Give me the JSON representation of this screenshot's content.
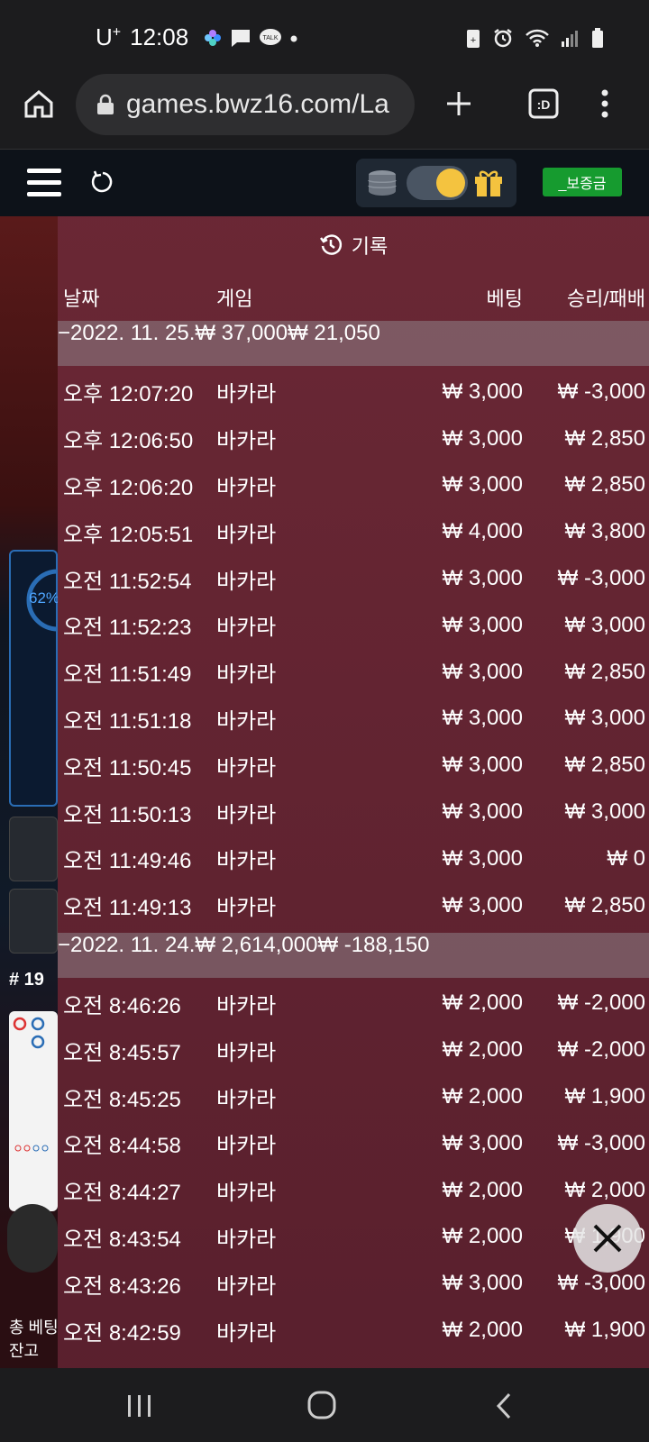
{
  "status_bar": {
    "carrier": "U",
    "carrier_sup": "+",
    "time": "12:08"
  },
  "browser": {
    "url": "games.bwz16.com/La"
  },
  "game_header": {
    "bonus_label": "_보증금"
  },
  "background": {
    "percent": "62%",
    "round_label": "# 19",
    "total_bet_label": "총 베팅",
    "balance_label": "잔고"
  },
  "history": {
    "title": "기록",
    "columns": [
      "날짜",
      "게임",
      "베팅",
      "승리/패배"
    ],
    "groups": [
      {
        "date": "−2022. 11. 25.",
        "total_bet": "₩ 37,000",
        "total_result": "₩ 21,050",
        "rows": [
          [
            "오후 12:07:20",
            "바카라",
            "₩ 3,000",
            "₩ -3,000"
          ],
          [
            "오후 12:06:50",
            "바카라",
            "₩ 3,000",
            "₩ 2,850"
          ],
          [
            "오후 12:06:20",
            "바카라",
            "₩ 3,000",
            "₩ 2,850"
          ],
          [
            "오후 12:05:51",
            "바카라",
            "₩ 4,000",
            "₩ 3,800"
          ],
          [
            "오전 11:52:54",
            "바카라",
            "₩ 3,000",
            "₩ -3,000"
          ],
          [
            "오전 11:52:23",
            "바카라",
            "₩ 3,000",
            "₩ 3,000"
          ],
          [
            "오전 11:51:49",
            "바카라",
            "₩ 3,000",
            "₩ 2,850"
          ],
          [
            "오전 11:51:18",
            "바카라",
            "₩ 3,000",
            "₩ 3,000"
          ],
          [
            "오전 11:50:45",
            "바카라",
            "₩ 3,000",
            "₩ 2,850"
          ],
          [
            "오전 11:50:13",
            "바카라",
            "₩ 3,000",
            "₩ 3,000"
          ],
          [
            "오전 11:49:46",
            "바카라",
            "₩ 3,000",
            "₩ 0"
          ],
          [
            "오전 11:49:13",
            "바카라",
            "₩ 3,000",
            "₩ 2,850"
          ]
        ]
      },
      {
        "date": "−2022. 11. 24.",
        "total_bet": "₩ 2,614,000",
        "total_result": "₩ -188,150",
        "rows": [
          [
            "오전 8:46:26",
            "바카라",
            "₩ 2,000",
            "₩ -2,000"
          ],
          [
            "오전 8:45:57",
            "바카라",
            "₩ 2,000",
            "₩ -2,000"
          ],
          [
            "오전 8:45:25",
            "바카라",
            "₩ 2,000",
            "₩ 1,900"
          ],
          [
            "오전 8:44:58",
            "바카라",
            "₩ 3,000",
            "₩ -3,000"
          ],
          [
            "오전 8:44:27",
            "바카라",
            "₩ 2,000",
            "₩ 2,000"
          ],
          [
            "오전 8:43:54",
            "바카라",
            "₩ 2,000",
            "₩ 1,900"
          ],
          [
            "오전 8:43:26",
            "바카라",
            "₩ 3,000",
            "₩ -3,000"
          ],
          [
            "오전 8:42:59",
            "바카라",
            "₩ 2,000",
            "₩ 1,900"
          ]
        ]
      }
    ]
  }
}
